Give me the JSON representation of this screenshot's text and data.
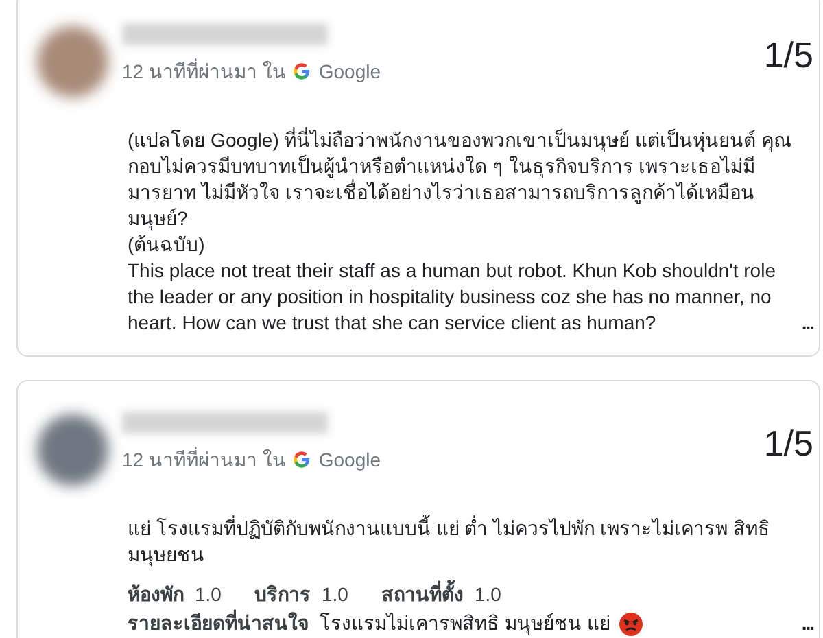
{
  "reviews": [
    {
      "time": "12 นาทีที่ผ่านมา ใน",
      "source": "Google",
      "rating": "1/5",
      "paragraphs": [
        "(แปลโดย Google) ที่นี่ไม่ถือว่าพนักงานของพวกเขาเป็นมนุษย์ แต่เป็นหุ่นยนต์ คุณกอบไม่ควรมีบทบาทเป็นผู้นำหรือตำแหน่งใด ๆ ในธุรกิจบริการ เพราะเธอไม่มีมารยาท ไม่มีหัวใจ เราจะเชื่อได้อย่างไรว่าเธอสามารถบริการลูกค้าได้เหมือนมนุษย์?",
        "(ต้นฉบับ)",
        "This place not treat their staff as a human but robot. Khun Kob shouldn't role the leader or any position in hospitality business coz she has no manner, no heart. How can we trust that she can service client as human?"
      ],
      "more": "..."
    },
    {
      "time": "12 นาทีที่ผ่านมา ใน",
      "source": "Google",
      "rating": "1/5",
      "paragraphs": [
        "แย่ โรงแรมที่ปฏิบัติกับพนักงานแบบนี้ แย่ ต่ำ ไม่ควรไปพัก เพราะไม่เคารพ สิทธิมนุษยชน"
      ],
      "aspects": [
        {
          "label": "ห้องพัก",
          "score": "1.0"
        },
        {
          "label": "บริการ",
          "score": "1.0"
        },
        {
          "label": "สถานที่ตั้ง",
          "score": "1.0"
        }
      ],
      "highlight": {
        "label": "รายละเอียดที่น่าสนใจ",
        "text": "โรงแรมไม่เคารพสิทธิ มนุษย์ชน แย่"
      },
      "more": "..."
    }
  ]
}
